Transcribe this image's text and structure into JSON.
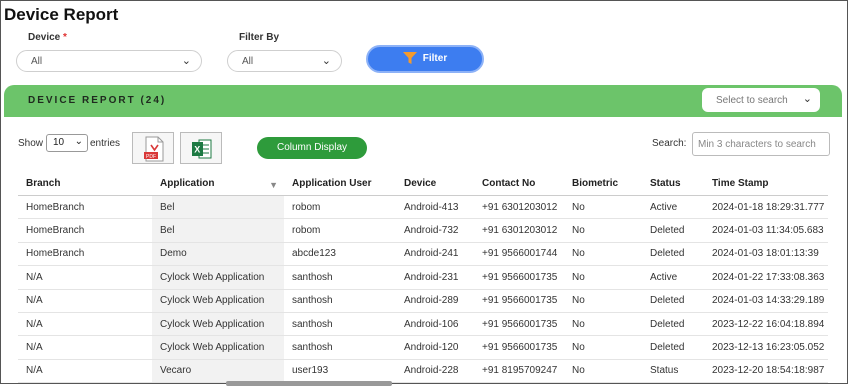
{
  "page": {
    "title": "Device Report"
  },
  "filters": {
    "device_label": "Device",
    "device_required": "*",
    "device_value": "All",
    "filter_by_label": "Filter By",
    "filter_by_value": "All",
    "filter_button": "Filter"
  },
  "panel": {
    "title": "DEVICE REPORT (24)",
    "select_placeholder": "Select to search"
  },
  "toolbar": {
    "show_label": "Show",
    "entries_value": "10",
    "entries_label": "entries",
    "pdf_icon": "pdf-icon",
    "excel_icon": "excel-icon",
    "column_display": "Column Display",
    "search_label": "Search:",
    "search_placeholder": "Min 3 characters to search"
  },
  "table": {
    "columns": [
      "Branch",
      "Application",
      "Application User",
      "Device",
      "Contact No",
      "Biometric",
      "Status",
      "Time Stamp"
    ],
    "rows": [
      [
        "HomeBranch",
        "Bel",
        "robom",
        "Android-413",
        "+91 6301203012",
        "No",
        "Active",
        "2024-01-18 18:29:31.777"
      ],
      [
        "HomeBranch",
        "Bel",
        "robom",
        "Android-732",
        "+91 6301203012",
        "No",
        "Deleted",
        "2024-01-03 11:34:05.683"
      ],
      [
        "HomeBranch",
        "Demo",
        "abcde123",
        "Android-241",
        "+91 9566001744",
        "No",
        "Deleted",
        "2024-01-03 18:01:13:39"
      ],
      [
        "N/A",
        "Cylock Web Application",
        "santhosh",
        "Android-231",
        "+91 9566001735",
        "No",
        "Active",
        "2024-01-22 17:33:08.363"
      ],
      [
        "N/A",
        "Cylock Web Application",
        "santhosh",
        "Android-289",
        "+91 9566001735",
        "No",
        "Deleted",
        "2024-01-03 14:33:29.189"
      ],
      [
        "N/A",
        "Cylock Web Application",
        "santhosh",
        "Android-106",
        "+91 9566001735",
        "No",
        "Deleted",
        "2023-12-22 16:04:18.894"
      ],
      [
        "N/A",
        "Cylock Web Application",
        "santhosh",
        "Android-120",
        "+91 9566001735",
        "No",
        "Deleted",
        "2023-12-13 16:23:05.052"
      ],
      [
        "N/A",
        "Vecaro",
        "user193",
        "Android-228",
        "+91 8195709247",
        "No",
        "Status",
        "2023-12-20 18:54:18:987"
      ]
    ]
  },
  "colors": {
    "accent": "#3d7df0",
    "panel": "#6cc46a",
    "button_green": "#2e9b3b"
  }
}
